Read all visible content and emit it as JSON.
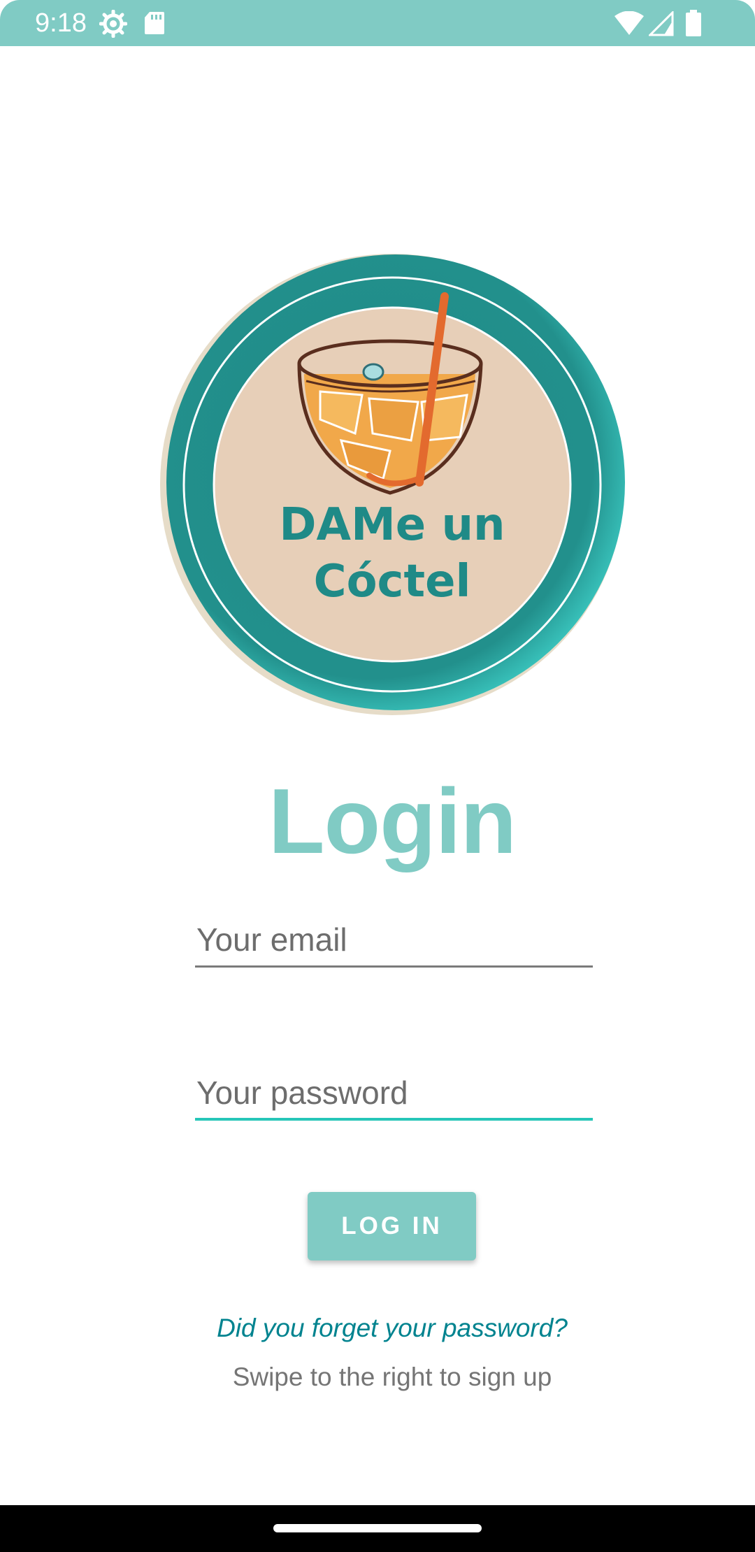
{
  "status_bar": {
    "time": "9:18",
    "icons": [
      "gear-icon",
      "sd-card-icon",
      "wifi-icon",
      "signal-icon",
      "battery-icon"
    ],
    "background_color": "#80cbc4"
  },
  "logo": {
    "line1": "DAMe un",
    "line2": "Cóctel"
  },
  "title": "Login",
  "email_field": {
    "value": "",
    "placeholder": "Your email"
  },
  "password_field": {
    "value": "",
    "placeholder": "Your password"
  },
  "login_button": {
    "label": "LOG IN"
  },
  "forgot_password_link": "Did you forget your password?",
  "signup_hint": "Swipe to the right to sign up",
  "colors": {
    "accent": "#80cbc4",
    "focus_underline": "#26c6b8",
    "link": "#00838f"
  }
}
